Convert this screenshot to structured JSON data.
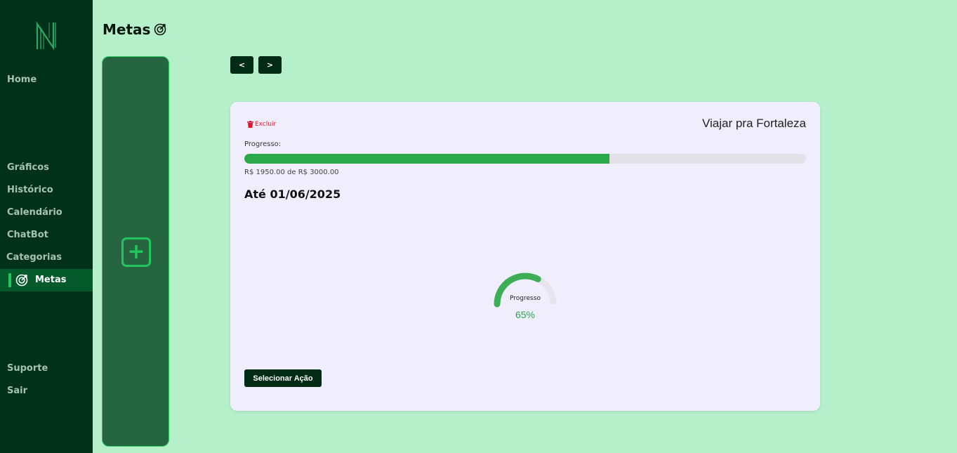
{
  "sidebar": {
    "items": [
      {
        "label": "Home"
      },
      {
        "label": "Gráficos"
      },
      {
        "label": "Histórico"
      },
      {
        "label": "Calendário"
      },
      {
        "label": "ChatBot"
      },
      {
        "label": "Categorias"
      },
      {
        "label": "Metas",
        "icon": "target-icon",
        "active": true
      },
      {
        "label": "Suporte"
      },
      {
        "label": "Sair"
      }
    ]
  },
  "header": {
    "title": "Metas",
    "icon": "target-icon"
  },
  "add_panel": {
    "icon": "plus-icon"
  },
  "pager": {
    "prev_label": "<",
    "next_label": ">"
  },
  "goal": {
    "delete_label": "Excluir",
    "name": "Viajar pra Fortaleza",
    "progress_label": "Progresso:",
    "progress_fraction": 0.65,
    "amount_text": "R$ 1950.00 de R$ 3000.00",
    "deadline": "Até 01/06/2025",
    "gauge_label": "Progresso",
    "gauge_value": "65%",
    "action_label": "Selecionar Ação"
  },
  "colors": {
    "page_bg": "#b6f0cb",
    "sidebar_bg": "#013219",
    "accent_green": "#2aa84a",
    "danger": "#e0172c"
  }
}
